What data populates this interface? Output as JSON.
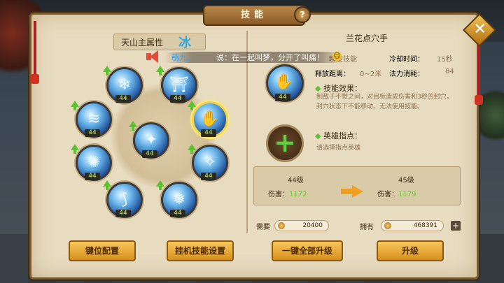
{
  "window": {
    "title": "技能",
    "help_label": "?",
    "close_label": "✕"
  },
  "left": {
    "attribute_label": "天山主属性",
    "attribute_value": "冰",
    "skills": [
      {
        "name": "skill-snowflake",
        "level": "44",
        "glyph": "❄"
      },
      {
        "name": "skill-ice-shrine",
        "level": "44",
        "glyph": "⛩"
      },
      {
        "name": "skill-ice-wave",
        "level": "44",
        "glyph": "≋"
      },
      {
        "name": "skill-lanhua-dianxue",
        "level": "44",
        "glyph": "✋",
        "selected": true
      },
      {
        "name": "skill-ice-figure",
        "level": "44",
        "glyph": "✦"
      },
      {
        "name": "skill-ice-burst",
        "level": "44",
        "glyph": "✺"
      },
      {
        "name": "skill-ice-palm",
        "level": "44",
        "glyph": "✧"
      },
      {
        "name": "skill-ice-sword",
        "level": "44",
        "glyph": "⟆"
      },
      {
        "name": "skill-ice-kick",
        "level": "44",
        "glyph": "❅"
      }
    ]
  },
  "chat": {
    "name": "萌九。",
    "message": "说：在一起叫梦，分开了叫痛！",
    "emoji": "☺"
  },
  "detail": {
    "skill_name": "兰花点穴手",
    "icon_level": "44",
    "type_value": "瞬发技能",
    "cooldown_label": "冷却时间：",
    "cooldown_value": "15秒",
    "range_label": "释放距离：",
    "range_value": "0~2米",
    "mana_label": "法力消耗：",
    "mana_value": "84",
    "effect_title": "技能效果：",
    "effect_text": "制敌于不觉之间，对目标造成伤害和3秒的封穴，封穴状态下不能移动、无法使用技能。",
    "hero_title": "英雄指点：",
    "hero_text": "请选择指点英雄"
  },
  "upgrade": {
    "current_level": "44级",
    "next_level": "45级",
    "damage_label": "伤害：",
    "current_damage": "1172",
    "next_damage": "1179"
  },
  "cost": {
    "need_label": "需要",
    "need_value": "20400",
    "have_label": "拥有",
    "have_value": "468391",
    "add_label": "+"
  },
  "buttons": {
    "keybind": "键位配置",
    "auto_skill": "挂机技能设置",
    "upgrade_all": "一键全部升级",
    "upgrade": "升级"
  }
}
